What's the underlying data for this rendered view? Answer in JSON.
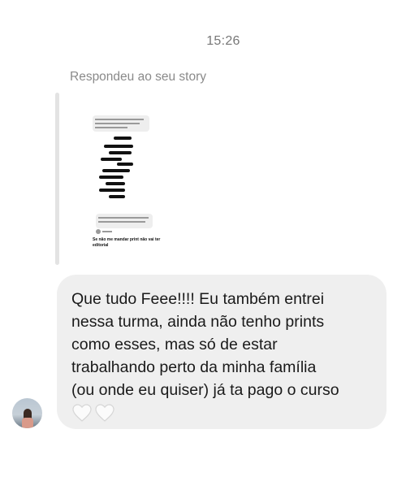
{
  "conversation": {
    "timestamp": "15:26",
    "reply_context_label": "Respondeu ao seu story"
  },
  "story_preview": {
    "caption": "Se não me mandar print não vai ter editorial"
  },
  "message": {
    "text": "Que tudo Feee!!!! Eu também entrei\nnessa turma, ainda não tenho prints\ncomo esses, mas só de estar\ntrabalhando perto da minha família\n(ou onde eu quiser) já ta pago o curso",
    "emoji_icons": [
      "white-heart-icon",
      "white-heart-icon"
    ]
  },
  "colors": {
    "bubble_background": "#efefef",
    "text": "#1a1a1a",
    "muted_text": "#8a8a8a"
  }
}
